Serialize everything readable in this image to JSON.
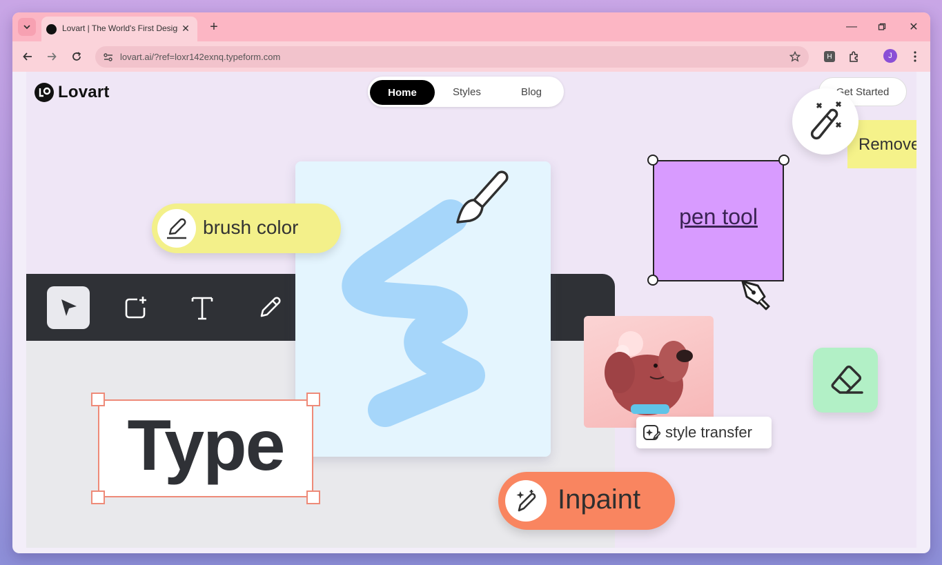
{
  "browser": {
    "tab_title": "Lovart | The World's First Design Agent",
    "url": "lovart.ai/?ref=loxr142exnq.typeform.com",
    "profile_initial": "J",
    "extension_label": "H"
  },
  "site": {
    "logo_text": "Lovart",
    "nav": {
      "home": "Home",
      "styles": "Styles",
      "blog": "Blog"
    },
    "cta": "Get Started"
  },
  "hero": {
    "brush_label": "brush color",
    "type_label": "Type",
    "pen_label": "pen tool",
    "remove_label": "Remove",
    "style_label": "style transfer",
    "inpaint_label": "Inpaint"
  },
  "colors": {
    "tab_bar": "#fcb6c4",
    "brush_pill": "#f3f08a",
    "pen_box": "#d89bff",
    "eraser_card": "#b2f0c6",
    "inpaint_pill": "#f98560",
    "stroke_blue": "#a6d6fa"
  }
}
